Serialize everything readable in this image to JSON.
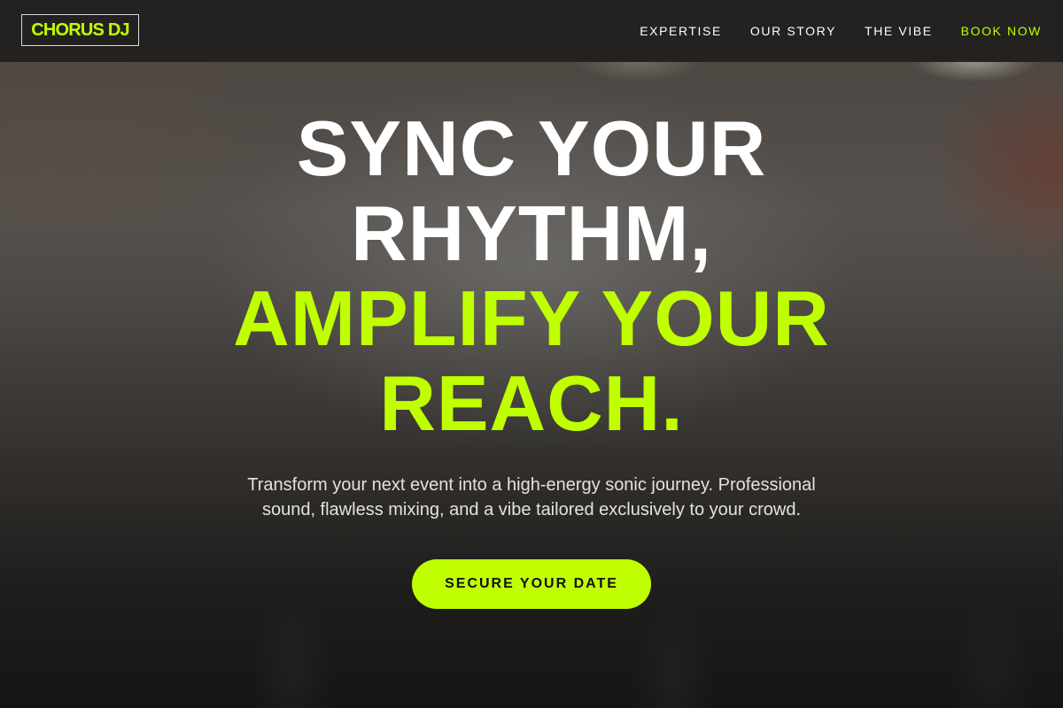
{
  "colors": {
    "accent": "#c0ff00",
    "header_bg": "#232221",
    "text_primary": "#ffffff",
    "text_secondary": "#e2e2e2"
  },
  "header": {
    "logo": "CHORUS DJ",
    "nav": [
      {
        "label": "EXPERTISE"
      },
      {
        "label": "OUR STORY"
      },
      {
        "label": "THE VIBE"
      },
      {
        "label": "BOOK NOW"
      }
    ]
  },
  "hero": {
    "headline_lines": [
      "SYNC YOUR",
      "RHYTHM,",
      "AMPLIFY YOUR",
      "REACH."
    ],
    "subtext": "Transform your next event into a high-energy sonic journey. Professional sound, flawless mixing, and a vibe tailored exclusively to your crowd.",
    "cta_label": "SECURE YOUR DATE"
  }
}
